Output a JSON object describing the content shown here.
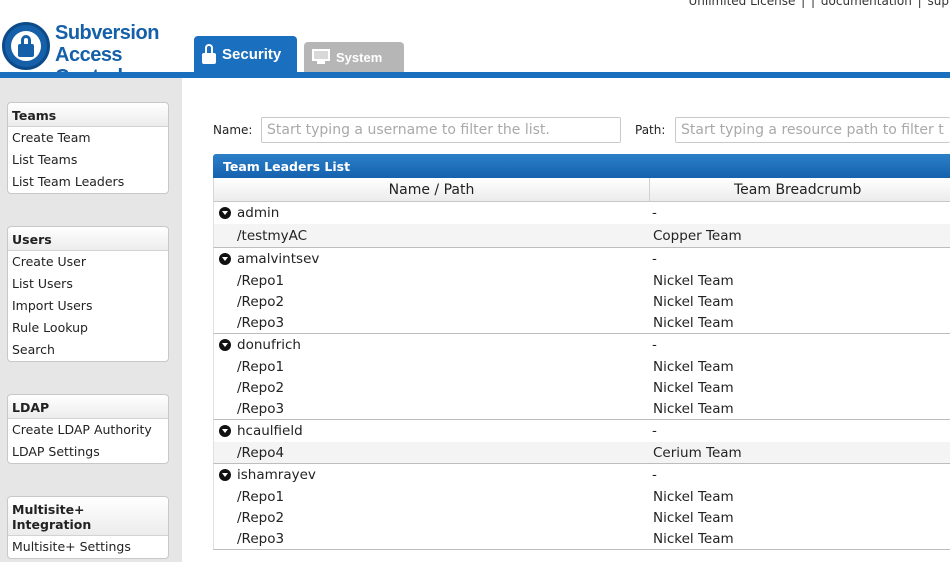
{
  "header": {
    "toplinks": [
      "Unlimited License",
      "|",
      "|",
      "documentation",
      "|",
      "sup"
    ],
    "logo": {
      "line1": "Subversion",
      "line2": "Access Control"
    },
    "tabs": [
      {
        "label": "Security",
        "icon": "lock-icon",
        "active": true
      },
      {
        "label": "System",
        "icon": "monitor-icon",
        "active": false
      }
    ],
    "accent_color": "#1a6fbe"
  },
  "sidebar": {
    "groups": [
      {
        "title": "Teams",
        "items": [
          "Create Team",
          "List Teams",
          "List Team Leaders"
        ]
      },
      {
        "title": "Users",
        "items": [
          "Create User",
          "List Users",
          "Import Users",
          "Rule Lookup",
          "Search"
        ]
      },
      {
        "title": "LDAP",
        "items": [
          "Create LDAP Authority",
          "LDAP Settings"
        ]
      },
      {
        "title": "Multisite+ Integration",
        "items": [
          "Multisite+ Settings"
        ]
      }
    ]
  },
  "filters": {
    "name_label": "Name:",
    "name_placeholder": "Start typing a username to filter the list.",
    "path_label": "Path:",
    "path_placeholder": "Start typing a resource path to filter the list."
  },
  "table": {
    "caption": "Team Leaders List",
    "columns": [
      "Name / Path",
      "Team Breadcrumb"
    ],
    "groups": [
      {
        "name": "admin",
        "breadcrumb": "-",
        "rows": [
          {
            "path": "/testmyAC",
            "team": "Copper Team"
          }
        ]
      },
      {
        "name": "amalvintsev",
        "breadcrumb": "-",
        "rows": [
          {
            "path": "/Repo1",
            "team": "Nickel Team"
          },
          {
            "path": "/Repo2",
            "team": "Nickel Team"
          },
          {
            "path": "/Repo3",
            "team": "Nickel Team"
          }
        ]
      },
      {
        "name": "donufrich",
        "breadcrumb": "-",
        "rows": [
          {
            "path": "/Repo1",
            "team": "Nickel Team"
          },
          {
            "path": "/Repo2",
            "team": "Nickel Team"
          },
          {
            "path": "/Repo3",
            "team": "Nickel Team"
          }
        ]
      },
      {
        "name": "hcaulfield",
        "breadcrumb": "-",
        "rows": [
          {
            "path": "/Repo4",
            "team": "Cerium Team"
          }
        ]
      },
      {
        "name": "ishamrayev",
        "breadcrumb": "-",
        "rows": [
          {
            "path": "/Repo1",
            "team": "Nickel Team"
          },
          {
            "path": "/Repo2",
            "team": "Nickel Team"
          },
          {
            "path": "/Repo3",
            "team": "Nickel Team"
          }
        ]
      }
    ]
  }
}
